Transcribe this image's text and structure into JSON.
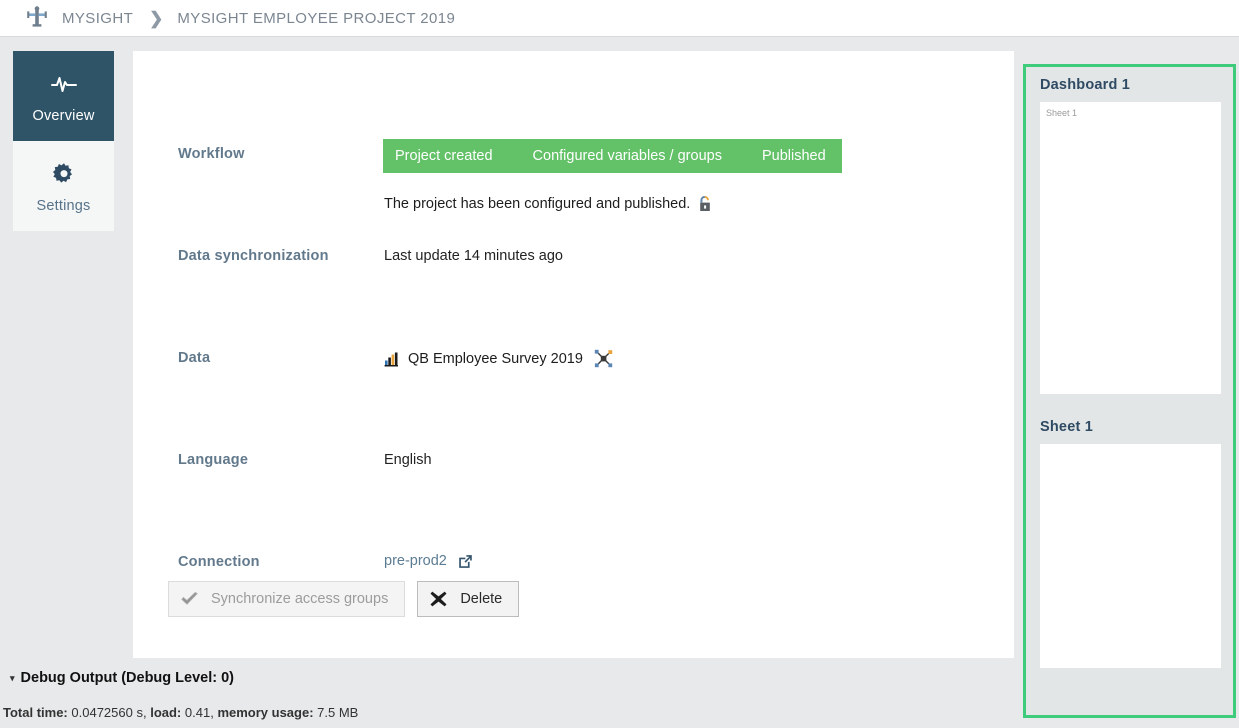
{
  "topbar": {
    "logo_icon": "person-figure-icon",
    "breadcrumb_root": "MYSIGHT",
    "breadcrumb_separator": "❯",
    "breadcrumb_current": "MYSIGHT EMPLOYEE PROJECT 2019"
  },
  "sidebar": {
    "items": [
      {
        "label": "Overview",
        "icon": "pulse-icon",
        "active": true
      },
      {
        "label": "Settings",
        "icon": "gear-icon",
        "active": false
      }
    ]
  },
  "main": {
    "rows": {
      "workflow": {
        "label": "Workflow",
        "steps": [
          "Project created",
          "Configured variables / groups",
          "Published"
        ],
        "status_text": "The project has been configured and published.",
        "status_icon": "unlock-icon"
      },
      "data_sync": {
        "label": "Data synchronization",
        "value": "Last update 14 minutes ago"
      },
      "data": {
        "label": "Data",
        "value": "QB Employee Survey 2019",
        "leading_icon": "bar-chart-icon",
        "trailing_icon": "network-nodes-icon"
      },
      "language": {
        "label": "Language",
        "value": "English"
      },
      "connection": {
        "label": "Connection",
        "value": "pre-prod2",
        "trailing_icon": "external-link-icon"
      }
    },
    "buttons": {
      "sync": {
        "label": "Synchronize access groups",
        "icon": "check-icon",
        "disabled": true
      },
      "delete": {
        "label": "Delete",
        "icon": "cross-icon",
        "disabled": false
      }
    }
  },
  "preview_panel": {
    "highlight_color": "#3ecb7c",
    "dashboard": {
      "title": "Dashboard 1",
      "canvas_label": "Sheet 1"
    },
    "sheet": {
      "title": "Sheet 1",
      "canvas_label": ""
    }
  },
  "debug": {
    "title": "Debug Output (Debug Level: 0)",
    "caret": "▾",
    "stats": {
      "total_time_label": "Total time:",
      "total_time_value": "0.0472560 s,",
      "load_label": "load:",
      "load_value": "0.41,",
      "memory_label": "memory usage:",
      "memory_value": "7.5 MB"
    }
  },
  "colors": {
    "workflow_green": "#63c168",
    "nav_active": "#2f5468",
    "page_bg": "#e7e9ea"
  }
}
